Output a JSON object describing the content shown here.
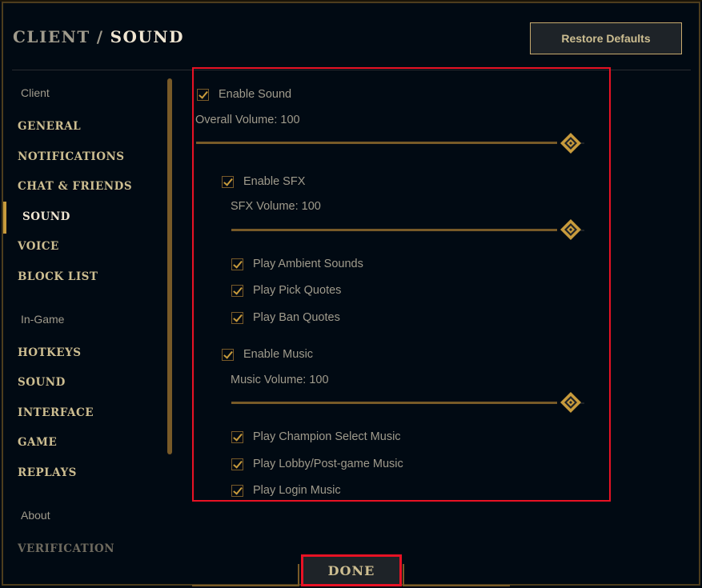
{
  "header": {
    "breadcrumb_parent": "CLIENT",
    "breadcrumb_separator": "/",
    "breadcrumb_current": "SOUND",
    "restore_defaults_label": "Restore Defaults"
  },
  "sidebar": {
    "sections": [
      {
        "header": "Client",
        "items": [
          {
            "label": "GENERAL",
            "active": false
          },
          {
            "label": "NOTIFICATIONS",
            "active": false
          },
          {
            "label": "CHAT & FRIENDS",
            "active": false
          },
          {
            "label": "SOUND",
            "active": true
          },
          {
            "label": "VOICE",
            "active": false
          },
          {
            "label": "BLOCK LIST",
            "active": false
          }
        ]
      },
      {
        "header": "In-Game",
        "items": [
          {
            "label": "HOTKEYS",
            "active": false
          },
          {
            "label": "SOUND",
            "active": false
          },
          {
            "label": "INTERFACE",
            "active": false
          },
          {
            "label": "GAME",
            "active": false
          },
          {
            "label": "REPLAYS",
            "active": false
          }
        ]
      },
      {
        "header": "About",
        "items": [
          {
            "label": "VERIFICATION",
            "active": false
          }
        ]
      }
    ]
  },
  "settings": {
    "enable_sound": {
      "label": "Enable Sound",
      "checked": true
    },
    "overall_volume": {
      "label": "Overall Volume: 100",
      "value": 100
    },
    "enable_sfx": {
      "label": "Enable SFX",
      "checked": true
    },
    "sfx_volume": {
      "label": "SFX Volume: 100",
      "value": 100
    },
    "play_ambient_sounds": {
      "label": "Play Ambient Sounds",
      "checked": true
    },
    "play_pick_quotes": {
      "label": "Play Pick Quotes",
      "checked": true
    },
    "play_ban_quotes": {
      "label": "Play Ban Quotes",
      "checked": true
    },
    "enable_music": {
      "label": "Enable Music",
      "checked": true
    },
    "music_volume": {
      "label": "Music Volume: 100",
      "value": 100
    },
    "play_champion_select_music": {
      "label": "Play Champion Select Music",
      "checked": true
    },
    "play_lobby_postgame_music": {
      "label": "Play Lobby/Post-game Music",
      "checked": true
    },
    "play_login_music": {
      "label": "Play Login Music",
      "checked": true
    }
  },
  "footer": {
    "done_label": "DONE"
  },
  "colors": {
    "background": "#010a13",
    "gold_accent": "#c89b3c",
    "gold_dark": "#785a28",
    "text_gold": "#cdbe91",
    "text_light": "#f0e6d2",
    "text_grey": "#a09b8c",
    "highlight_red": "#e81224"
  }
}
